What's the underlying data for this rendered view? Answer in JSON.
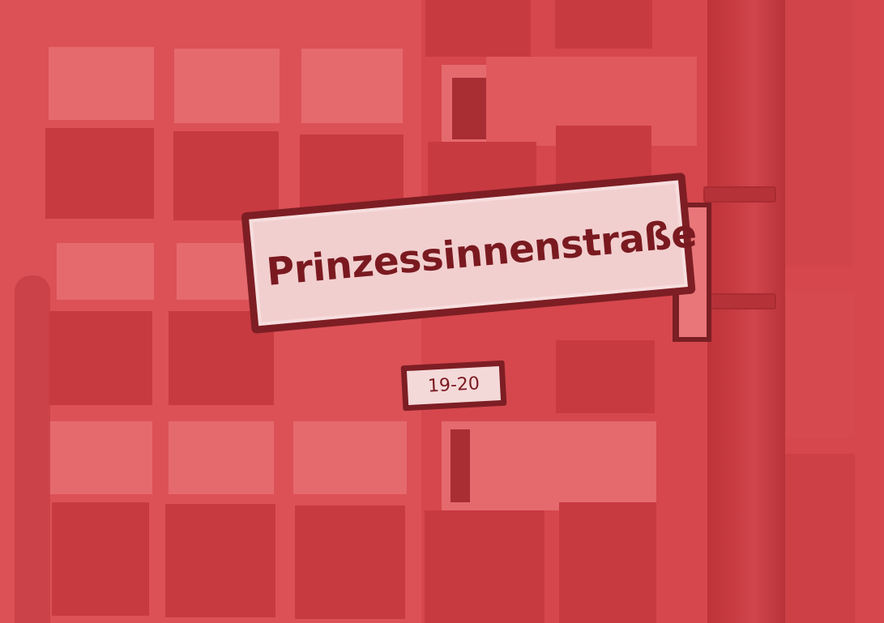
{
  "photo": {
    "tint_color": "#d4444a",
    "street_sign": {
      "name": "Prinzessinnenstraße",
      "house_numbers": "19-20"
    }
  }
}
